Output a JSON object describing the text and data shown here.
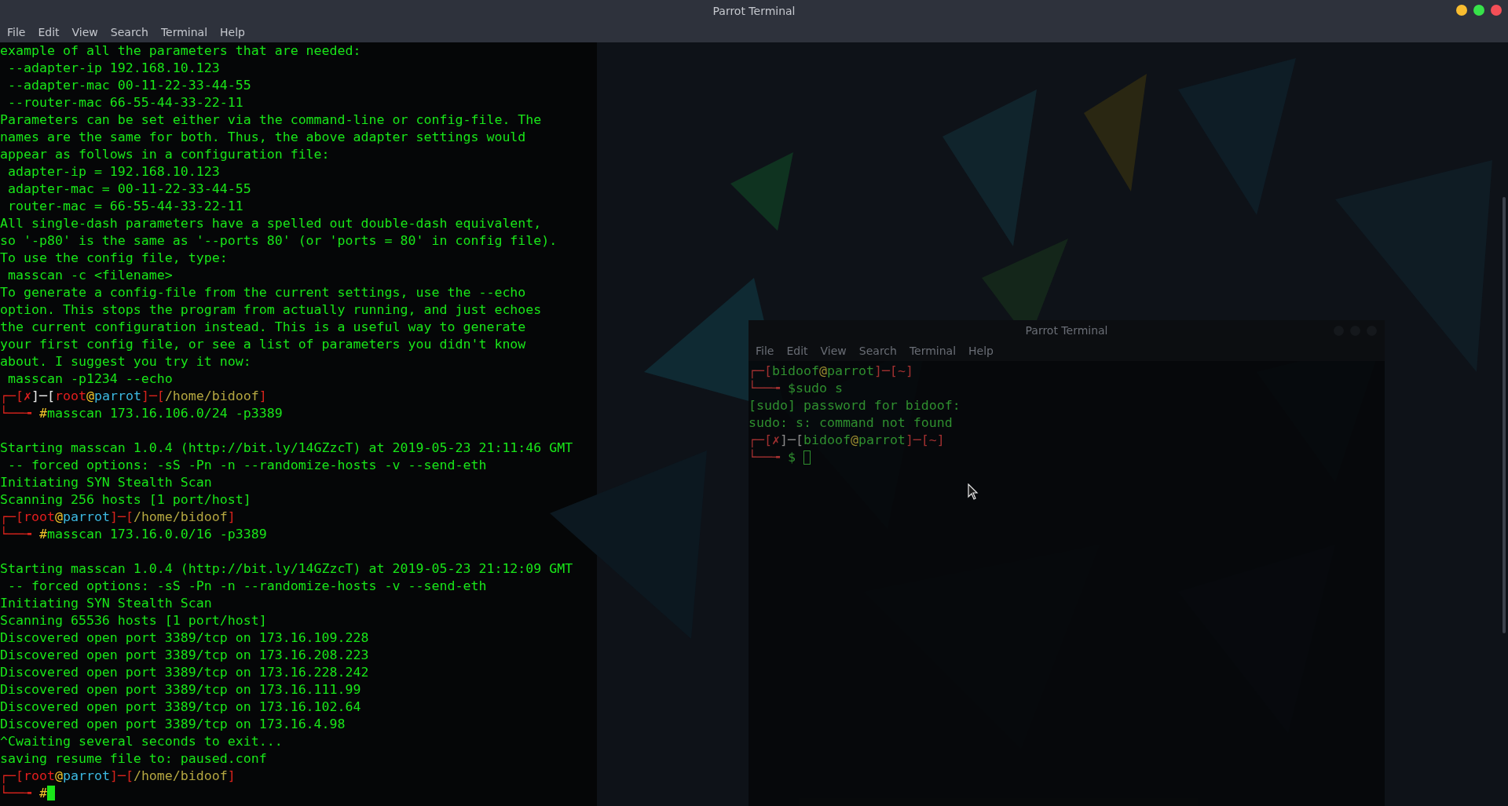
{
  "window": {
    "title": "Parrot Terminal",
    "controls": [
      {
        "color": "#f9bd30"
      },
      {
        "color": "#37e24a"
      },
      {
        "color": "#f44f57"
      }
    ]
  },
  "menu": [
    "File",
    "Edit",
    "View",
    "Search",
    "Terminal",
    "Help"
  ],
  "lines": [
    {
      "kind": "text",
      "text": "example of all the parameters that are needed:"
    },
    {
      "kind": "text",
      "text": " --adapter-ip 192.168.10.123"
    },
    {
      "kind": "text",
      "text": " --adapter-mac 00-11-22-33-44-55"
    },
    {
      "kind": "text",
      "text": " --router-mac 66-55-44-33-22-11"
    },
    {
      "kind": "text",
      "text": "Parameters can be set either via the command-line or config-file. The"
    },
    {
      "kind": "text",
      "text": "names are the same for both. Thus, the above adapter settings would"
    },
    {
      "kind": "text",
      "text": "appear as follows in a configuration file:"
    },
    {
      "kind": "text",
      "text": " adapter-ip = 192.168.10.123"
    },
    {
      "kind": "text",
      "text": " adapter-mac = 00-11-22-33-44-55"
    },
    {
      "kind": "text",
      "text": " router-mac = 66-55-44-33-22-11"
    },
    {
      "kind": "text",
      "text": "All single-dash parameters have a spelled out double-dash equivalent,"
    },
    {
      "kind": "text",
      "text": "so '-p80' is the same as '--ports 80' (or 'ports = 80' in config file)."
    },
    {
      "kind": "text",
      "text": "To use the config file, type:"
    },
    {
      "kind": "text",
      "text": " masscan -c <filename>"
    },
    {
      "kind": "text",
      "text": "To generate a config-file from the current settings, use the --echo"
    },
    {
      "kind": "text",
      "text": "option. This stops the program from actually running, and just echoes"
    },
    {
      "kind": "text",
      "text": "the current configuration instead. This is a useful way to generate"
    },
    {
      "kind": "text",
      "text": "your first config file, or see a list of parameters you didn't know"
    },
    {
      "kind": "text",
      "text": "about. I suggest you try it now:"
    },
    {
      "kind": "text",
      "text": " masscan -p1234 --echo"
    },
    {
      "kind": "prompt",
      "segments": [
        {
          "text": "┌─[",
          "color": "#d8231c"
        },
        {
          "text": "✗",
          "color": "#e01e1e"
        },
        {
          "text": "]─[",
          "color": "#e8e8e8"
        },
        {
          "text": "root",
          "color": "#e61e1e"
        },
        {
          "text": "@",
          "color": "#f0c42a"
        },
        {
          "text": "parrot",
          "color": "#3cb8e0"
        },
        {
          "text": "]─[",
          "color": "#d8231c"
        },
        {
          "text": "/home/bidoof",
          "color": "#b3a640"
        },
        {
          "text": "]",
          "color": "#d8231c"
        }
      ]
    },
    {
      "kind": "prompt",
      "segments": [
        {
          "text": "└──╼ ",
          "color": "#d8231c"
        },
        {
          "text": "#",
          "color": "#f0c42a"
        },
        {
          "text": "masscan 173.16.106.0/24 -p3389",
          "color": "#19e619"
        }
      ]
    },
    {
      "kind": "blank"
    },
    {
      "kind": "text",
      "text": "Starting masscan 1.0.4 (http://bit.ly/14GZzcT) at 2019-05-23 21:11:46 GMT"
    },
    {
      "kind": "text",
      "text": " -- forced options: -sS -Pn -n --randomize-hosts -v --send-eth"
    },
    {
      "kind": "text",
      "text": "Initiating SYN Stealth Scan"
    },
    {
      "kind": "text",
      "text": "Scanning 256 hosts [1 port/host]"
    },
    {
      "kind": "prompt",
      "segments": [
        {
          "text": "┌─[",
          "color": "#d8231c"
        },
        {
          "text": "root",
          "color": "#e61e1e"
        },
        {
          "text": "@",
          "color": "#f0c42a"
        },
        {
          "text": "parrot",
          "color": "#3cb8e0"
        },
        {
          "text": "]─[",
          "color": "#d8231c"
        },
        {
          "text": "/home/bidoof",
          "color": "#b3a640"
        },
        {
          "text": "]",
          "color": "#d8231c"
        }
      ]
    },
    {
      "kind": "prompt",
      "segments": [
        {
          "text": "└──╼ ",
          "color": "#d8231c"
        },
        {
          "text": "#",
          "color": "#f0c42a"
        },
        {
          "text": "masscan 173.16.0.0/16 -p3389",
          "color": "#19e619"
        }
      ]
    },
    {
      "kind": "blank"
    },
    {
      "kind": "text",
      "text": "Starting masscan 1.0.4 (http://bit.ly/14GZzcT) at 2019-05-23 21:12:09 GMT"
    },
    {
      "kind": "text",
      "text": " -- forced options: -sS -Pn -n --randomize-hosts -v --send-eth"
    },
    {
      "kind": "text",
      "text": "Initiating SYN Stealth Scan"
    },
    {
      "kind": "text",
      "text": "Scanning 65536 hosts [1 port/host]"
    },
    {
      "kind": "text",
      "text": "Discovered open port 3389/tcp on 173.16.109.228"
    },
    {
      "kind": "text",
      "text": "Discovered open port 3389/tcp on 173.16.208.223"
    },
    {
      "kind": "text",
      "text": "Discovered open port 3389/tcp on 173.16.228.242"
    },
    {
      "kind": "text",
      "text": "Discovered open port 3389/tcp on 173.16.111.99"
    },
    {
      "kind": "text",
      "text": "Discovered open port 3389/tcp on 173.16.102.64"
    },
    {
      "kind": "text",
      "text": "Discovered open port 3389/tcp on 173.16.4.98"
    },
    {
      "kind": "text",
      "text": "^Cwaiting several seconds to exit..."
    },
    {
      "kind": "text",
      "text": "saving resume file to: paused.conf"
    },
    {
      "kind": "prompt",
      "segments": [
        {
          "text": "┌─[",
          "color": "#d8231c"
        },
        {
          "text": "root",
          "color": "#e61e1e"
        },
        {
          "text": "@",
          "color": "#f0c42a"
        },
        {
          "text": "parrot",
          "color": "#3cb8e0"
        },
        {
          "text": "]─[",
          "color": "#d8231c"
        },
        {
          "text": "/home/bidoof",
          "color": "#b3a640"
        },
        {
          "text": "]",
          "color": "#d8231c"
        }
      ]
    },
    {
      "kind": "prompt",
      "cursor": true,
      "segments": [
        {
          "text": "└──╼ ",
          "color": "#d8231c"
        },
        {
          "text": "#",
          "color": "#f0c42a"
        }
      ]
    }
  ],
  "background_window": {
    "title": "Parrot Terminal",
    "menu": [
      "File",
      "Edit",
      "View",
      "Search",
      "Terminal",
      "Help"
    ],
    "lines": [
      {
        "kind": "prompt",
        "segments": [
          {
            "text": "┌─[",
            "color": "#a03030"
          },
          {
            "text": "bidoof",
            "color": "#2f8f2f"
          },
          {
            "text": "@",
            "color": "#9a8a30"
          },
          {
            "text": "parrot",
            "color": "#2f8f2f"
          },
          {
            "text": "]─[",
            "color": "#a03030"
          },
          {
            "text": "~",
            "color": "#a03030"
          },
          {
            "text": "]",
            "color": "#a03030"
          }
        ]
      },
      {
        "kind": "prompt",
        "segments": [
          {
            "text": "└──╼ ",
            "color": "#a03030"
          },
          {
            "text": "$sudo s",
            "color": "#2f8f2f"
          }
        ]
      },
      {
        "kind": "text",
        "text": "[sudo] password for bidoof:"
      },
      {
        "kind": "text",
        "text": "sudo: s: command not found"
      },
      {
        "kind": "prompt",
        "segments": [
          {
            "text": "┌─[",
            "color": "#a03030"
          },
          {
            "text": "✗",
            "color": "#a03030"
          },
          {
            "text": "]─[",
            "color": "#8a8a8a"
          },
          {
            "text": "bidoof",
            "color": "#2f8f2f"
          },
          {
            "text": "@",
            "color": "#9a8a30"
          },
          {
            "text": "parrot",
            "color": "#2f8f2f"
          },
          {
            "text": "]─[",
            "color": "#a03030"
          },
          {
            "text": "~",
            "color": "#a03030"
          },
          {
            "text": "]",
            "color": "#a03030"
          }
        ]
      },
      {
        "kind": "prompt",
        "cursor": true,
        "segments": [
          {
            "text": "└──╼ ",
            "color": "#a03030"
          },
          {
            "text": "$ ",
            "color": "#2f8f2f"
          }
        ]
      }
    ]
  }
}
